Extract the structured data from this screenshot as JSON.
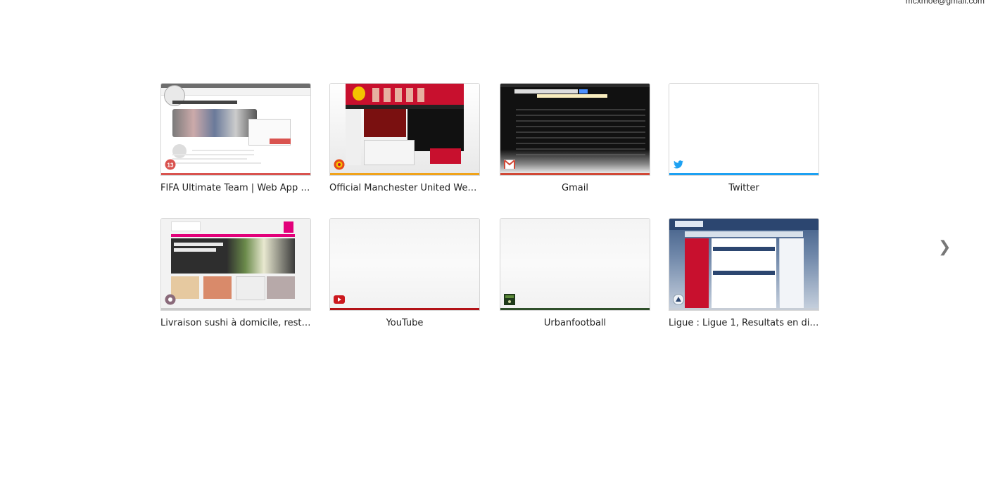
{
  "account": {
    "email": "mcxmoe@gmail.com"
  },
  "tiles": [
    {
      "title": "FIFA Ultimate Team | Web App | ...",
      "bar_color": "#d9534f",
      "icon": "fifa-13-icon"
    },
    {
      "title": "Official Manchester United Websi...",
      "bar_color": "#f0a31a",
      "icon": "manchester-united-crest-icon"
    },
    {
      "title": "Gmail",
      "bar_color": "#d14836",
      "icon": "gmail-icon"
    },
    {
      "title": "Twitter",
      "bar_color": "#1da1f2",
      "icon": "twitter-bird-icon"
    },
    {
      "title": "Livraison sushi à domicile, restau...",
      "bar_color": "#c9c9c9",
      "icon": "planet-sushi-icon"
    },
    {
      "title": "YouTube",
      "bar_color": "#b31217",
      "icon": "youtube-icon"
    },
    {
      "title": "Urbanfootball",
      "bar_color": "#2f4f2a",
      "icon": "urbanfootball-icon"
    },
    {
      "title": "Ligue : Ligue 1, Resultats en direc...",
      "bar_color": "#c7cdd6",
      "icon": "ligue1-icon"
    }
  ],
  "navigation": {
    "next_label": "❯"
  }
}
